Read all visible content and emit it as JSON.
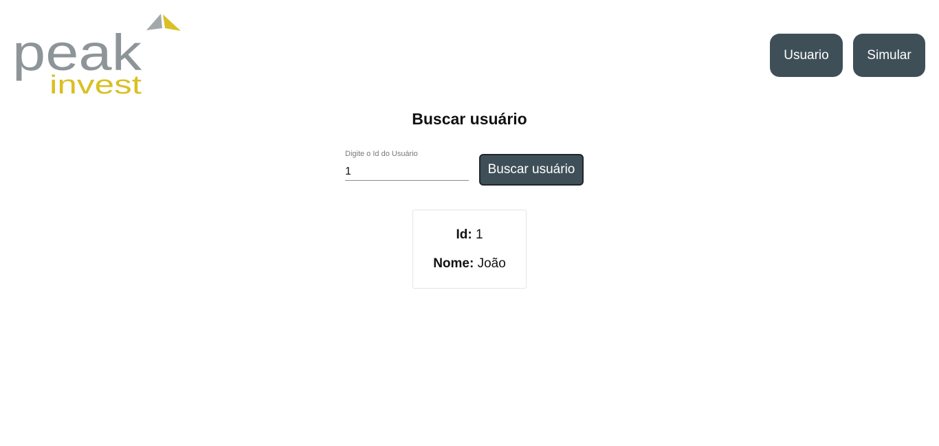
{
  "header": {
    "logo": {
      "word_top": "peak",
      "word_bottom": "invest",
      "colors": {
        "gray": "#8e9598",
        "yellow": "#d9c024",
        "arrow_gray": "#a3a8ab"
      }
    },
    "nav": {
      "usuario_label": "Usuario",
      "simular_label": "Simular"
    }
  },
  "main": {
    "title": "Buscar usuário",
    "search": {
      "label": "Digite o Id do Usuário",
      "value": "1",
      "button_label": "Buscar usuário"
    },
    "result": {
      "id_label": "Id:",
      "id_value": "1",
      "nome_label": "Nome:",
      "nome_value": "João"
    }
  },
  "colors": {
    "button_bg": "#3f4f58",
    "button_text": "#ffffff"
  }
}
